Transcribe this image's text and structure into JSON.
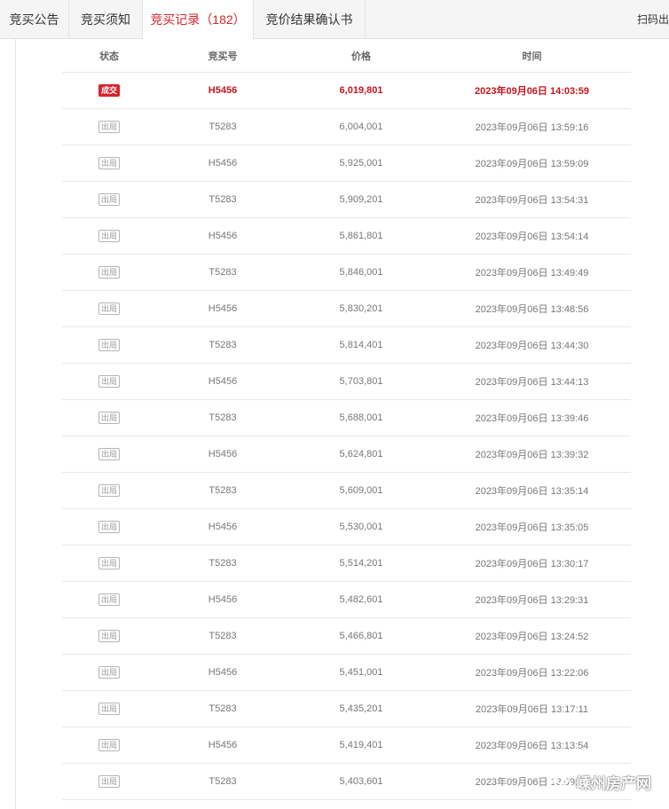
{
  "tabs": [
    {
      "label": "竞买公告"
    },
    {
      "label": "竞买须知"
    },
    {
      "label": "竞买记录",
      "count": "（182）"
    },
    {
      "label": "竞价结果确认书"
    }
  ],
  "scan_label": "扫码出",
  "table": {
    "headers": [
      "状态",
      "竞买号",
      "价格",
      "时间"
    ],
    "rows": [
      {
        "status": "成交",
        "bidder": "H5456",
        "price": "6,019,801",
        "time": "2023年09月06日 14:03:59"
      },
      {
        "status": "出局",
        "bidder": "T5283",
        "price": "6,004,001",
        "time": "2023年09月06日 13:59:16"
      },
      {
        "status": "出局",
        "bidder": "H5456",
        "price": "5,925,001",
        "time": "2023年09月06日 13:59:09"
      },
      {
        "status": "出局",
        "bidder": "T5283",
        "price": "5,909,201",
        "time": "2023年09月06日 13:54:31"
      },
      {
        "status": "出局",
        "bidder": "H5456",
        "price": "5,861,801",
        "time": "2023年09月06日 13:54:14"
      },
      {
        "status": "出局",
        "bidder": "T5283",
        "price": "5,846,001",
        "time": "2023年09月06日 13:49:49"
      },
      {
        "status": "出局",
        "bidder": "H5456",
        "price": "5,830,201",
        "time": "2023年09月06日 13:48:56"
      },
      {
        "status": "出局",
        "bidder": "T5283",
        "price": "5,814,401",
        "time": "2023年09月06日 13:44:30"
      },
      {
        "status": "出局",
        "bidder": "H5456",
        "price": "5,703,801",
        "time": "2023年09月06日 13:44:13"
      },
      {
        "status": "出局",
        "bidder": "T5283",
        "price": "5,688,001",
        "time": "2023年09月06日 13:39:46"
      },
      {
        "status": "出局",
        "bidder": "H5456",
        "price": "5,624,801",
        "time": "2023年09月06日 13:39:32"
      },
      {
        "status": "出局",
        "bidder": "T5283",
        "price": "5,609,001",
        "time": "2023年09月06日 13:35:14"
      },
      {
        "status": "出局",
        "bidder": "H5456",
        "price": "5,530,001",
        "time": "2023年09月06日 13:35:05"
      },
      {
        "status": "出局",
        "bidder": "T5283",
        "price": "5,514,201",
        "time": "2023年09月06日 13:30:17"
      },
      {
        "status": "出局",
        "bidder": "H5456",
        "price": "5,482,601",
        "time": "2023年09月06日 13:29:31"
      },
      {
        "status": "出局",
        "bidder": "T5283",
        "price": "5,466,801",
        "time": "2023年09月06日 13:24:52"
      },
      {
        "status": "出局",
        "bidder": "H5456",
        "price": "5,451,001",
        "time": "2023年09月06日 13:22:06"
      },
      {
        "status": "出局",
        "bidder": "T5283",
        "price": "5,435,201",
        "time": "2023年09月06日 13:17:11"
      },
      {
        "status": "出局",
        "bidder": "H5456",
        "price": "5,419,401",
        "time": "2023年09月06日 13:13:54"
      },
      {
        "status": "出局",
        "bidder": "T5283",
        "price": "5,403,601",
        "time": "2023年09月06日 13:09:56"
      }
    ]
  },
  "watermark": "嵊州房产网",
  "colors": {
    "accent": "#d9232d",
    "win_text": "#c8141e"
  }
}
